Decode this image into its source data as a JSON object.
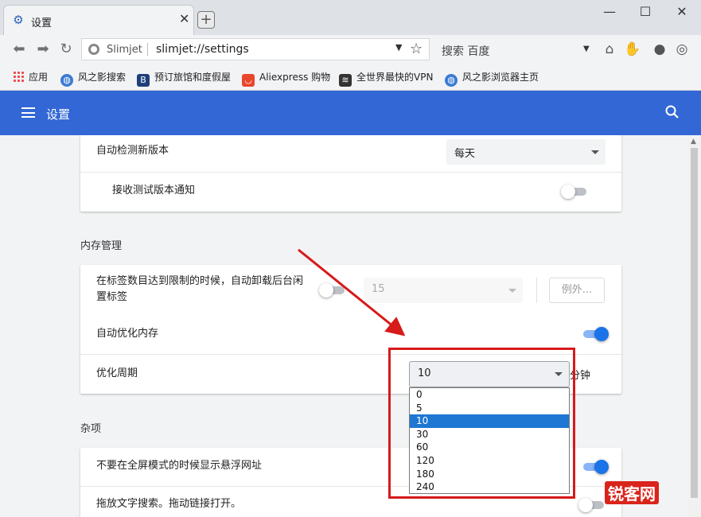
{
  "window": {
    "tab_title": "设置",
    "new_tab": "+",
    "minimize": "—",
    "maximize": "☐",
    "close": "✕"
  },
  "toolbar": {
    "site_name": "Slimjet",
    "url": "slimjet://settings",
    "search_placeholder": "搜索 百度"
  },
  "bookmarks": [
    {
      "label": "应用",
      "icon": "apps-grid-icon"
    },
    {
      "label": "风之影搜索",
      "icon": "globe-icon"
    },
    {
      "label": "预订旅馆和度假屋",
      "icon": "booking-icon"
    },
    {
      "label": "Aliexpress 购物",
      "icon": "aliexpress-icon"
    },
    {
      "label": "全世界最快的VPN",
      "icon": "vpn-icon"
    },
    {
      "label": "风之影浏览器主页",
      "icon": "globe-icon"
    }
  ],
  "header": {
    "title": "设置"
  },
  "update_card": {
    "auto_check_label": "自动检测新版本",
    "auto_check_value": "每天",
    "beta_label": "接收测试版本通知",
    "beta_enabled": false
  },
  "memory": {
    "section_title": "内存管理",
    "unload_label_line1": "在标签数目达到限制的时候，自动卸载后台闲",
    "unload_label_line2": "置标签",
    "unload_enabled": false,
    "unload_limit": "15",
    "exceptions_button": "例外...",
    "auto_optimize_label": "自动优化内存",
    "auto_optimize_enabled": true,
    "period_label": "优化周期",
    "period_value": "10",
    "period_unit": "分钟",
    "period_options": [
      "0",
      "5",
      "10",
      "30",
      "60",
      "120",
      "180",
      "240"
    ]
  },
  "misc": {
    "section_title": "杂项",
    "no_float_url_label": "不要在全屏模式的时候显示悬浮网址",
    "no_float_url_enabled": true,
    "drag_search_label": "拖放文字搜索。拖动链接打开。",
    "drag_search_enabled": false
  },
  "watermark": {
    "text": "锐客网"
  },
  "colors": {
    "header_blue": "#3367d6",
    "toggle_on": "#1a73e8",
    "highlight_red": "#d71a1a",
    "selected_option": "#1e77d3"
  }
}
